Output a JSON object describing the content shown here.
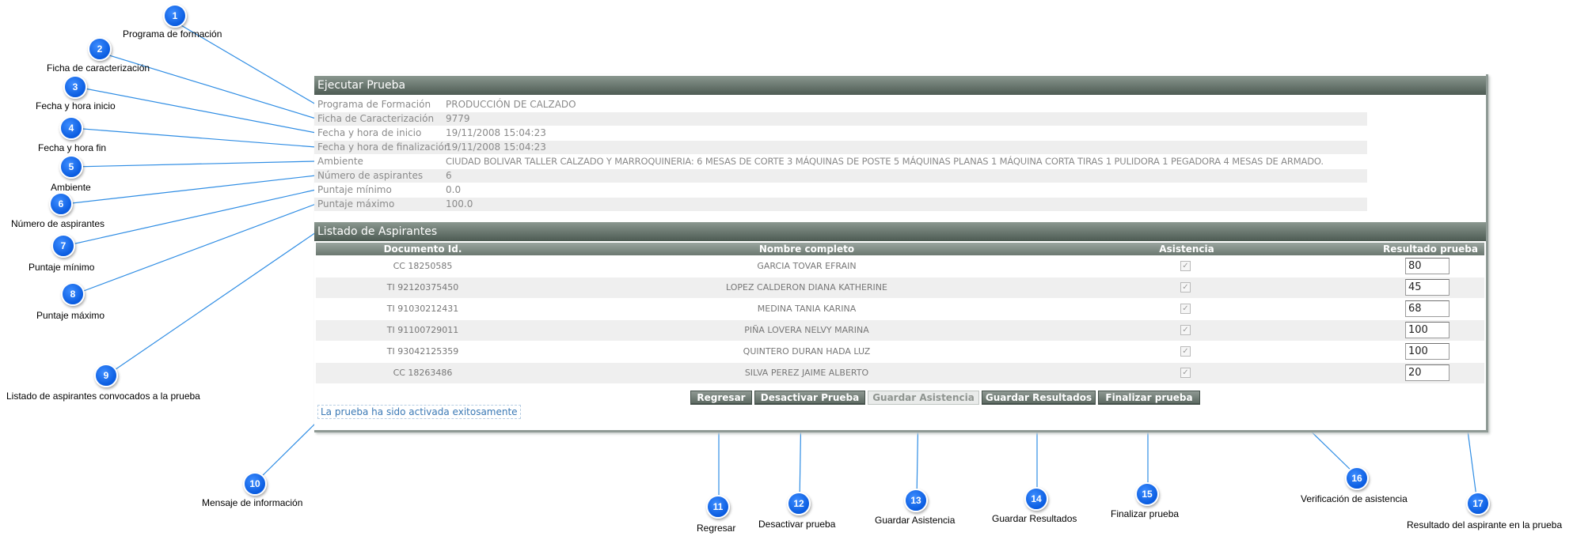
{
  "panel": {
    "title": "Ejecutar Prueba",
    "info": [
      {
        "label": "Programa de Formación",
        "value": "PRODUCCIÓN DE CALZADO"
      },
      {
        "label": "Ficha de Caracterización",
        "value": "9779"
      },
      {
        "label": "Fecha y hora de inicio",
        "value": "19/11/2008 15:04:23"
      },
      {
        "label": "Fecha y hora de finalización",
        "value": "19/11/2008 15:04:23"
      },
      {
        "label": "Ambiente",
        "value": "CIUDAD BOLIVAR TALLER CALZADO Y MARROQUINERIA: 6 MESAS DE CORTE 3 MÁQUINAS DE POSTE 5 MÁQUINAS PLANAS 1 MÁQUINA CORTA TIRAS 1 PULIDORA 1 PEGADORA 4 MESAS DE ARMADO."
      },
      {
        "label": "Número de aspirantes",
        "value": "6"
      },
      {
        "label": "Puntaje mínimo",
        "value": "0.0"
      },
      {
        "label": "Puntaje máximo",
        "value": "100.0"
      }
    ],
    "list_title": "Listado de Aspirantes",
    "columns": [
      "Documento Id.",
      "Nombre completo",
      "Asistencia",
      "Resultado prueba"
    ],
    "rows": [
      {
        "doc": "CC 18250585",
        "name": "GARCIA TOVAR EFRAIN",
        "attended": true,
        "score": "80"
      },
      {
        "doc": "TI 92120375450",
        "name": "LOPEZ CALDERON DIANA KATHERINE",
        "attended": true,
        "score": "45"
      },
      {
        "doc": "TI 91030212431",
        "name": "MEDINA TANIA KARINA",
        "attended": true,
        "score": "68"
      },
      {
        "doc": "TI 91100729011",
        "name": "PIÑA LOVERA NELVY MARINA",
        "attended": true,
        "score": "100"
      },
      {
        "doc": "TI 93042125359",
        "name": "QUINTERO DURAN HADA LUZ",
        "attended": true,
        "score": "100"
      },
      {
        "doc": "CC 18263486",
        "name": "SILVA PEREZ JAIME ALBERTO",
        "attended": true,
        "score": "20"
      }
    ],
    "buttons": {
      "back": "Regresar",
      "deactivate": "Desactivar Prueba",
      "save_attendance": "Guardar Asistencia",
      "save_results": "Guardar Resultados",
      "finish": "Finalizar prueba"
    },
    "message": "La prueba ha sido activada exitosamente"
  },
  "annotations": [
    {
      "num": "1",
      "text": "Programa de formación"
    },
    {
      "num": "2",
      "text": "Ficha de caracterización"
    },
    {
      "num": "3",
      "text": "Fecha y hora inicio"
    },
    {
      "num": "4",
      "text": "Fecha y hora fin"
    },
    {
      "num": "5",
      "text": "Ambiente"
    },
    {
      "num": "6",
      "text": "Número de aspirantes"
    },
    {
      "num": "7",
      "text": "Puntaje mínimo"
    },
    {
      "num": "8",
      "text": "Puntaje máximo"
    },
    {
      "num": "9",
      "text": "Listado de aspirantes convocados a la prueba"
    },
    {
      "num": "10",
      "text": "Mensaje de información"
    },
    {
      "num": "11",
      "text": "Regresar"
    },
    {
      "num": "12",
      "text": "Desactivar prueba"
    },
    {
      "num": "13",
      "text": "Guardar Asistencia"
    },
    {
      "num": "14",
      "text": "Guardar Resultados"
    },
    {
      "num": "15",
      "text": "Finalizar prueba"
    },
    {
      "num": "16",
      "text": "Verificación de asistencia"
    },
    {
      "num": "17",
      "text": "Resultado del aspirante en la prueba"
    }
  ],
  "colors": {
    "accent": "#0a5ce0",
    "header": "#4d5b53",
    "leader_line": "#2f8de4"
  }
}
